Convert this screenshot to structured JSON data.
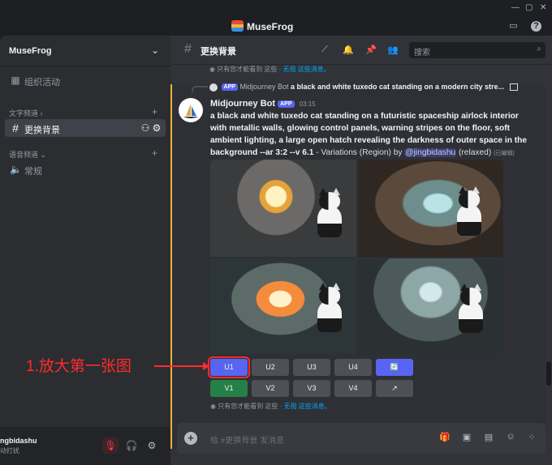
{
  "app": {
    "title": "MuseFrog",
    "win_min": "—",
    "win_max": "▢",
    "win_close": "✕"
  },
  "server": {
    "name": "MuseFrog"
  },
  "sidebar": {
    "events_label": "组织活动",
    "text_category": "文字频道 ›",
    "voice_category": "语音频道 ⌄",
    "channel_label": "更换背景",
    "voice_channel_label": "常规"
  },
  "user": {
    "name": "ngbidashu",
    "status": "动打扰"
  },
  "channel": {
    "name": "更换背景",
    "search_placeholder": "搜索"
  },
  "ephemeral_top": {
    "text": "只有您才能看到 这些 · ",
    "link": "无视 这些消息。"
  },
  "reply": {
    "tag": "APP",
    "author": "Midjourney Bot",
    "snippet": "a black and white tuxedo cat standing on a modern city stre..."
  },
  "message": {
    "author": "Midjourney Bot",
    "tag": "APP",
    "time": "03:15",
    "prompt": "a black and white tuxedo cat standing on a futuristic spaceship airlock interior with metallic walls, glowing control panels, warning stripes on the floor, soft ambient lighting, a large open hatch revealing the darkness of outer space in the background --ar 3:2 --v 6.1",
    "suffix": " - Variations (Region) by ",
    "mention": "@jingbidashu",
    "mode": " (relaxed)",
    "edited": "(已编辑)"
  },
  "buttons_row1": [
    "U1",
    "U2",
    "U3",
    "U4",
    "🔄"
  ],
  "buttons_row2": [
    "V1",
    "V2",
    "V3",
    "V4",
    "↗"
  ],
  "ephemeral_bottom": {
    "text": "只有您才能看到 这些 · ",
    "link": "无视 这些消息。"
  },
  "annotation": {
    "text": "1.放大第一张图"
  },
  "composer": {
    "placeholder": "给 #更换背景 发消息"
  },
  "colors": {
    "accent": "#5865f2",
    "annotation": "#ff2b2b",
    "green": "#248046"
  }
}
